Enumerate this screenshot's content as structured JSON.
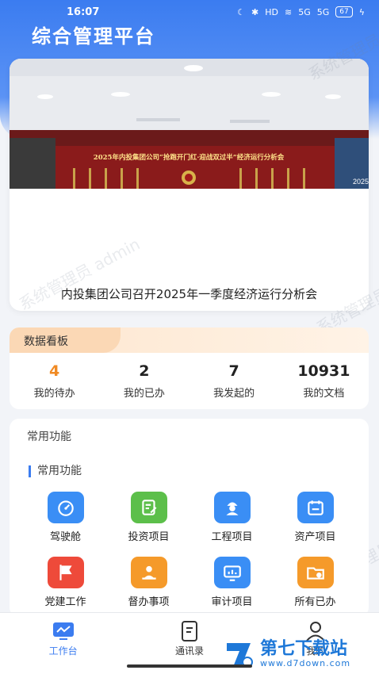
{
  "status_bar": {
    "time": "16:07",
    "network": "HD",
    "signal1": "5G",
    "signal2": "5G",
    "battery": "67"
  },
  "app": {
    "title": "综合管理平台"
  },
  "banner": {
    "photo_title": "2025年内投集团公司“抢跑开门红·迎战双过半”经济运行分析会",
    "photo_badge": "2025",
    "caption": "内投集团公司召开2025年一季度经济运行分析会"
  },
  "watermark": {
    "text": "系统管理员 admin"
  },
  "stats": {
    "title": "数据看板",
    "items": [
      {
        "value": "4",
        "label": "我的待办"
      },
      {
        "value": "2",
        "label": "我的已办"
      },
      {
        "value": "7",
        "label": "我发起的"
      },
      {
        "value": "10931",
        "label": "我的文档"
      }
    ]
  },
  "functions": {
    "title": "常用功能",
    "subtitle": "常用功能",
    "items": [
      {
        "label": "驾驶舱",
        "icon": "dashboard-icon",
        "color": "#3a8ef5"
      },
      {
        "label": "投资项目",
        "icon": "edit-document-icon",
        "color": "#5cbf4a"
      },
      {
        "label": "工程项目",
        "icon": "worker-icon",
        "color": "#3a8ef5"
      },
      {
        "label": "资产项目",
        "icon": "calendar-icon",
        "color": "#3a8ef5"
      },
      {
        "label": "党建工作",
        "icon": "flag-icon",
        "color": "#ee4a3a"
      },
      {
        "label": "督办事项",
        "icon": "supervisor-icon",
        "color": "#f59a2a"
      },
      {
        "label": "审计项目",
        "icon": "monitor-icon",
        "color": "#3a8ef5"
      },
      {
        "label": "所有已办",
        "icon": "folder-check-icon",
        "color": "#f59a2a"
      }
    ]
  },
  "tabbar": {
    "items": [
      {
        "label": "工作台",
        "icon": "chart-monitor-icon",
        "active": true
      },
      {
        "label": "通讯录",
        "icon": "contacts-book-icon",
        "active": false
      },
      {
        "label": "我的",
        "icon": "user-icon",
        "active": false
      }
    ]
  },
  "site_logo": {
    "main": "第七下载站",
    "sub": "www.d7down.com"
  },
  "colors": {
    "primary": "#3b7cf0",
    "accent_orange": "#f08a24"
  }
}
